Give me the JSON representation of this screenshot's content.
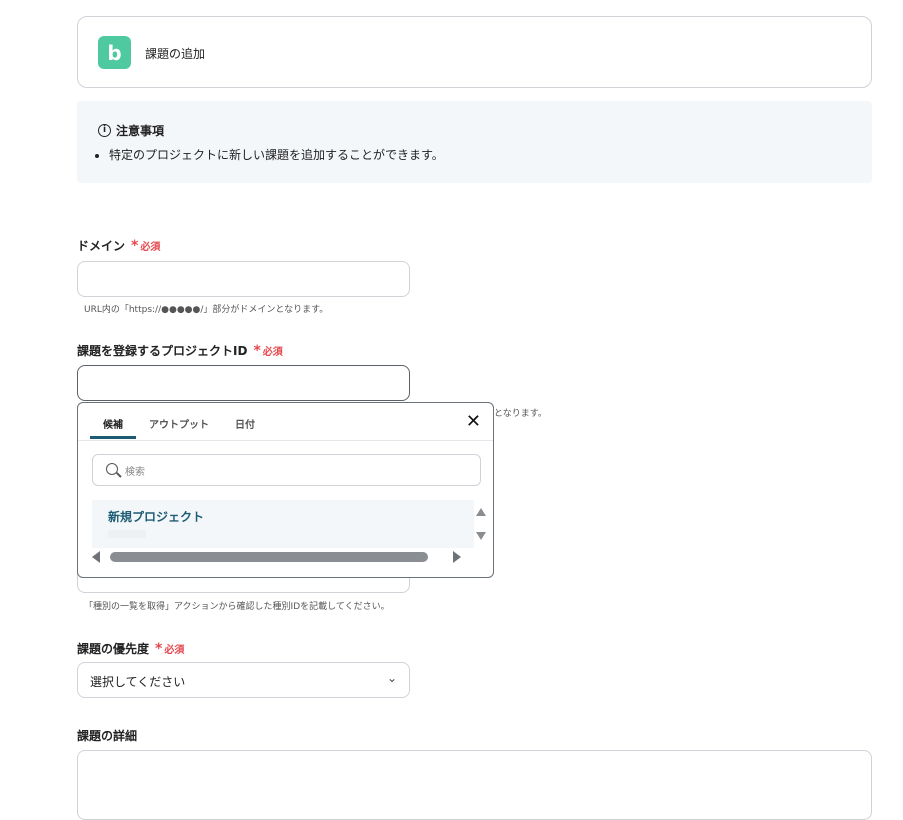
{
  "app": {
    "logo_text": "b",
    "title": "課題の追加"
  },
  "notice": {
    "title": "注意事項",
    "items": [
      "特定のプロジェクトに新しい課題を追加することができます。"
    ]
  },
  "required_label": "必須",
  "fields": {
    "domain": {
      "label": "ドメイン",
      "value": "",
      "hint": "URL内の「https://●●●●●/」部分がドメインとなります。"
    },
    "project_id": {
      "label": "課題を登録するプロジェクトID",
      "value": "",
      "hint_tail": "となります。"
    },
    "issue_type": {
      "hint": "「種別の一覧を取得」アクションから確認した種別IDを記載してください。"
    },
    "priority": {
      "label": "課題の優先度",
      "selected": "選択してください"
    },
    "description": {
      "label": "課題の詳細",
      "value": ""
    }
  },
  "dropdown": {
    "tabs": [
      "候補",
      "アウトプット",
      "日付"
    ],
    "active_tab": "候補",
    "search_placeholder": "検索",
    "options": [
      {
        "label": "新規プロジェクト"
      }
    ]
  },
  "colors": {
    "brand": "#4fc9a0",
    "required": "#e5484d",
    "accent": "#1b5c73"
  }
}
